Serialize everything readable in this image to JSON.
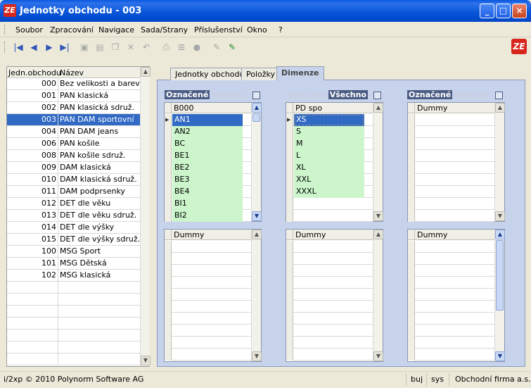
{
  "window": {
    "title": "Jednotky obchodu - 003",
    "icon": "app-logo-icon",
    "controls": [
      "_",
      "□",
      "×"
    ]
  },
  "menu": [
    "Soubor",
    "Zpracování",
    "Navigace",
    "Sada/Strany",
    "Příslušenství",
    "Okno",
    "?"
  ],
  "toolbar": {
    "icons": [
      "first-record-icon",
      "prev-record-icon",
      "next-record-icon",
      "last-record-icon",
      "save-icon",
      "new-icon",
      "copy-icon",
      "delete-icon",
      "undo-icon",
      "print-icon",
      "tree-icon",
      "stop-icon",
      "edit-icon",
      "highlight-icon"
    ],
    "glyphs": [
      "|◀",
      "◀",
      "▶",
      "▶|",
      "▣",
      "▤",
      "❐",
      "✕",
      "↶",
      "⎙",
      "⊞",
      "●",
      "✎",
      "✎"
    ]
  },
  "left_grid": {
    "headers": [
      "Jedn.obchodu",
      "Název"
    ],
    "rows": [
      [
        "000",
        "Bez velikosti a barev"
      ],
      [
        "001",
        "PAN klasická"
      ],
      [
        "002",
        "PAN klasická sdruž."
      ],
      [
        "003",
        "PAN DAM sportovní"
      ],
      [
        "004",
        "PAN DAM jeans"
      ],
      [
        "006",
        "PAN košile"
      ],
      [
        "008",
        "PAN košile sdruž."
      ],
      [
        "009",
        "DAM klasická"
      ],
      [
        "010",
        "DAM klasická sdruž."
      ],
      [
        "011",
        "DAM podprsenky"
      ],
      [
        "012",
        "DET dle věku"
      ],
      [
        "013",
        "DET dle věku sdruž."
      ],
      [
        "014",
        "DET dle výšky"
      ],
      [
        "015",
        "DET dle výšky sdruž."
      ],
      [
        "100",
        "MSG Sport"
      ],
      [
        "101",
        "MSG Dětská"
      ],
      [
        "102",
        "MSG klasická"
      ]
    ],
    "selected_index": 3
  },
  "tabs": [
    "Jednotky obchodu",
    "Položky",
    "Dimenze"
  ],
  "active_tab": 2,
  "panel_header": {
    "marked": "Označené",
    "all": "Všechno"
  },
  "upper_grids": [
    {
      "column": "B000",
      "rows": [
        "AN1",
        "AN2",
        "BC",
        "BE1",
        "BE2",
        "BE3",
        "BE4",
        "BI1",
        "BI2"
      ],
      "mode": "marked"
    },
    {
      "column": "PD spo",
      "rows": [
        "XS",
        "S",
        "M",
        "L",
        "XL",
        "XXL",
        "XXXL"
      ],
      "mode": "all"
    },
    {
      "column": "Dummy",
      "rows": [],
      "mode": "marked"
    }
  ],
  "lower_grids": [
    {
      "column": "Dummy"
    },
    {
      "column": "Dummy"
    },
    {
      "column": "Dummy"
    }
  ],
  "status": {
    "copyright": "i/2xp © 2010 Polynorm Software AG",
    "user": "buj",
    "db": "sys",
    "company": "Obchodní firma a.s."
  },
  "colors": {
    "selection": "#316ac5",
    "marked_bg": "#ccf5cc",
    "panel_bg": "#c7d3ea"
  }
}
